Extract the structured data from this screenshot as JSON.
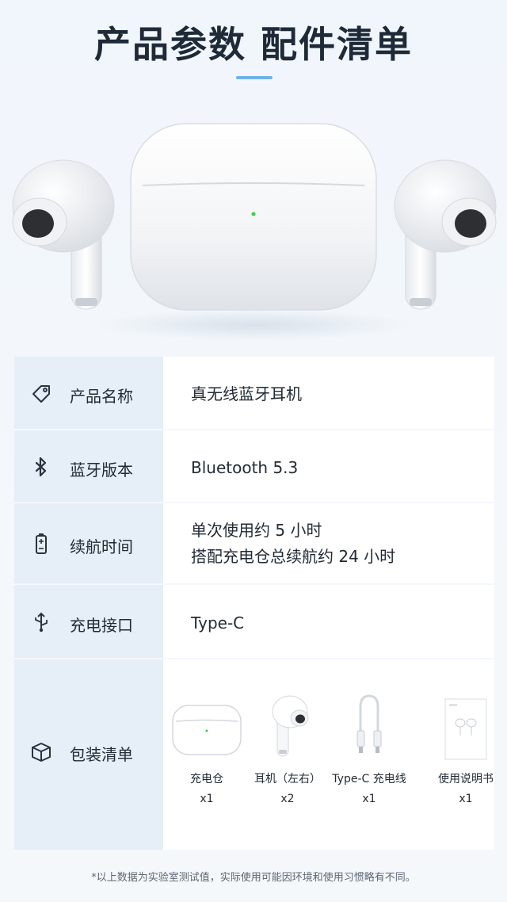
{
  "header": {
    "title": "产品参数 配件清单"
  },
  "specs": {
    "name": {
      "label": "产品名称",
      "value": "真无线蓝牙耳机",
      "icon": "tag-icon"
    },
    "bluetooth": {
      "label": "蓝牙版本",
      "value": "Bluetooth 5.3",
      "icon": "bluetooth-icon"
    },
    "battery": {
      "label": "续航时间",
      "value_line1": "单次使用约 5 小时",
      "value_line2": "搭配充电仓总续航约 24 小时",
      "icon": "battery-icon"
    },
    "port": {
      "label": "充电接口",
      "value": "Type-C",
      "icon": "usb-icon"
    },
    "package": {
      "label": "包装清单",
      "icon": "box-icon"
    }
  },
  "package_items": [
    {
      "name": "充电仓",
      "qty": "x1",
      "icon": "charging-case-icon"
    },
    {
      "name": "耳机（左右）",
      "qty": "x2",
      "icon": "earbud-icon"
    },
    {
      "name": "Type-C 充电线",
      "qty": "x1",
      "icon": "cable-icon"
    },
    {
      "name": "使用说明书",
      "qty": "x1",
      "icon": "manual-icon"
    }
  ],
  "footnote": "*以上数据为实验室测试值，实际使用可能因环境和使用习惯略有不同。",
  "colors": {
    "label_bg": "#e6eef8",
    "accent": "#6fb2e6",
    "led": "#3ccf4e"
  }
}
